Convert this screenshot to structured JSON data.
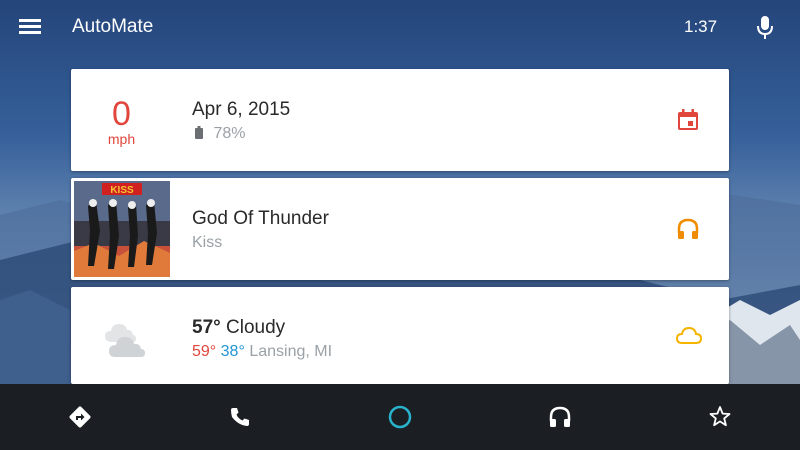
{
  "app": {
    "title": "AutoMate"
  },
  "status": {
    "time": "1:37"
  },
  "cards": {
    "speed": {
      "value": "0",
      "unit": "mph",
      "date": "Apr 6, 2015",
      "battery": "78%",
      "icon": "calendar-icon"
    },
    "music": {
      "title": "God Of Thunder",
      "artist": "Kiss",
      "icon": "headphones-icon",
      "album_art": "kiss-album-art"
    },
    "weather": {
      "temp": "57°",
      "condition": "Cloudy",
      "high": "59°",
      "low": "38°",
      "location": "Lansing, MI",
      "icon": "cloud-icon",
      "condition_icon": "cloudy-weather-icon"
    }
  },
  "bottom_nav": [
    {
      "name": "navigation",
      "icon": "directions-icon"
    },
    {
      "name": "phone",
      "icon": "phone-icon"
    },
    {
      "name": "home",
      "icon": "home-circle-icon"
    },
    {
      "name": "music",
      "icon": "headphones-icon"
    },
    {
      "name": "favorites",
      "icon": "star-icon"
    }
  ],
  "colors": {
    "accent_red": "#e0463c",
    "accent_orange": "#f08c00",
    "accent_yellow": "#f4b400",
    "accent_teal": "#28b3cc",
    "low_temp_blue": "#2196d3",
    "bottom_bar": "#1b1e22"
  }
}
